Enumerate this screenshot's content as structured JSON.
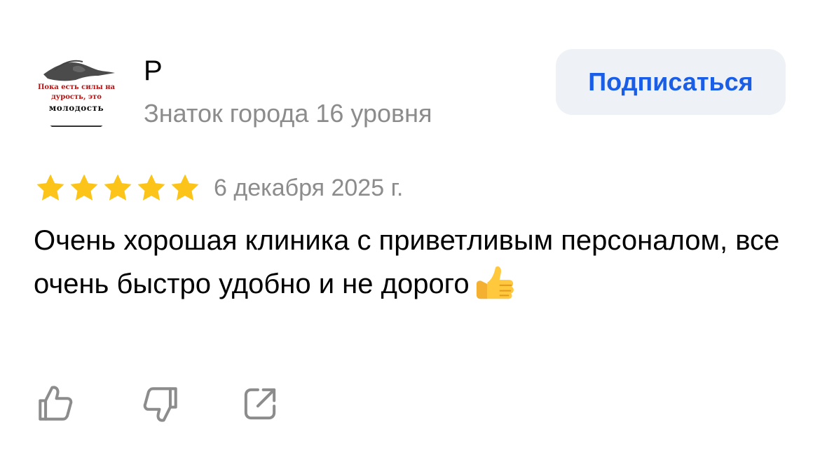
{
  "author": {
    "avatar_text": [
      "Пока есть силы на",
      "дурость, это",
      "молодость"
    ],
    "name": "Р",
    "level": "Знаток города 16 уровня"
  },
  "subscribe_button": {
    "label": "Подписаться"
  },
  "rating": {
    "stars": 5,
    "max": 5,
    "color": "#fcc419"
  },
  "date": "6 декабря 2025 г.",
  "review_text": "Очень хорошая клиника с приветливым персоналом, все очень быстро удобно и не дорого",
  "actions": [
    {
      "icon": "thumbs-up-icon"
    },
    {
      "icon": "thumbs-down-icon"
    },
    {
      "icon": "share-icon"
    }
  ],
  "colors": {
    "accent": "#1a5de6",
    "subscribe_bg": "#eef1f6",
    "secondary_text": "#8c8c8c",
    "icon_gray": "#8c8c8c"
  }
}
